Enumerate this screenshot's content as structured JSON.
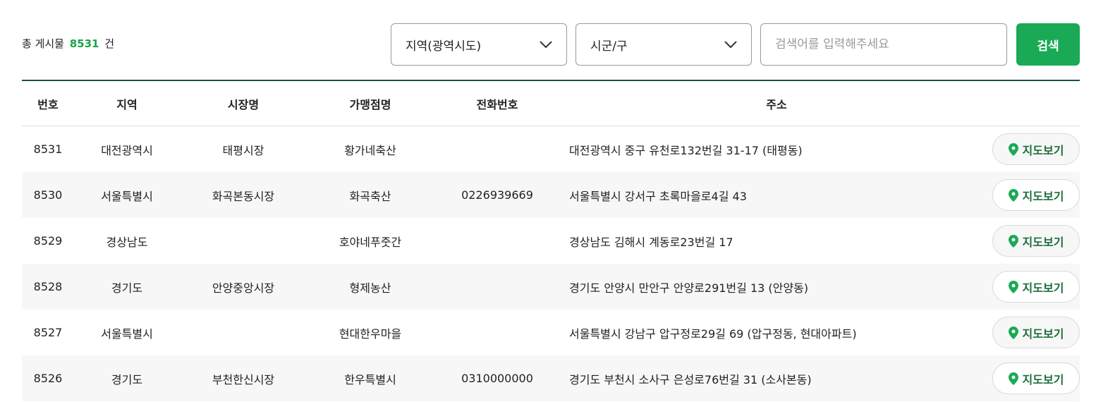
{
  "summary": {
    "prefix": "총 게시물",
    "count": "8531",
    "suffix": "건"
  },
  "filters": {
    "region": {
      "selected": "지역(광역시도)"
    },
    "district": {
      "selected": "시군/구"
    },
    "search": {
      "placeholder": "검색어를 입력해주세요",
      "value": ""
    },
    "search_button": "검색"
  },
  "table": {
    "headers": {
      "no": "번호",
      "region": "지역",
      "market": "시장명",
      "store": "가맹점명",
      "phone": "전화번호",
      "address": "주소"
    },
    "map_button_label": "지도보기",
    "rows": [
      {
        "no": "8531",
        "region": "대전광역시",
        "market": "태평시장",
        "store": "황가네축산",
        "phone": "",
        "address": "대전광역시 중구 유천로132번길 31-17 (태평동)"
      },
      {
        "no": "8530",
        "region": "서울특별시",
        "market": "화곡본동시장",
        "store": "화곡축산",
        "phone": "0226939669",
        "address": "서울특별시 강서구 초록마을로4길 43"
      },
      {
        "no": "8529",
        "region": "경상남도",
        "market": "",
        "store": "호야네푸줏간",
        "phone": "",
        "address": "경상남도 김해시 계동로23번길 17"
      },
      {
        "no": "8528",
        "region": "경기도",
        "market": "안양중앙시장",
        "store": "형제농산",
        "phone": "",
        "address": "경기도 안양시 만안구 안양로291번길 13 (안양동)"
      },
      {
        "no": "8527",
        "region": "서울특별시",
        "market": "",
        "store": "현대한우마을",
        "phone": "",
        "address": "서울특별시 강남구 압구정로29길 69 (압구정동, 현대아파트)"
      },
      {
        "no": "8526",
        "region": "경기도",
        "market": "부천한신시장",
        "store": "한우특별시",
        "phone": "0310000000",
        "address": "경기도 부천시 소사구 은성로76번길 31 (소사본동)"
      }
    ]
  },
  "colors": {
    "accent_green": "#1aaa55",
    "count_green": "#1aa34a",
    "header_rule": "#1f4f4a",
    "map_pin": "#1aaa55"
  },
  "icons": {
    "dropdown": "chevron-down-icon",
    "map": "map-pin-icon"
  }
}
